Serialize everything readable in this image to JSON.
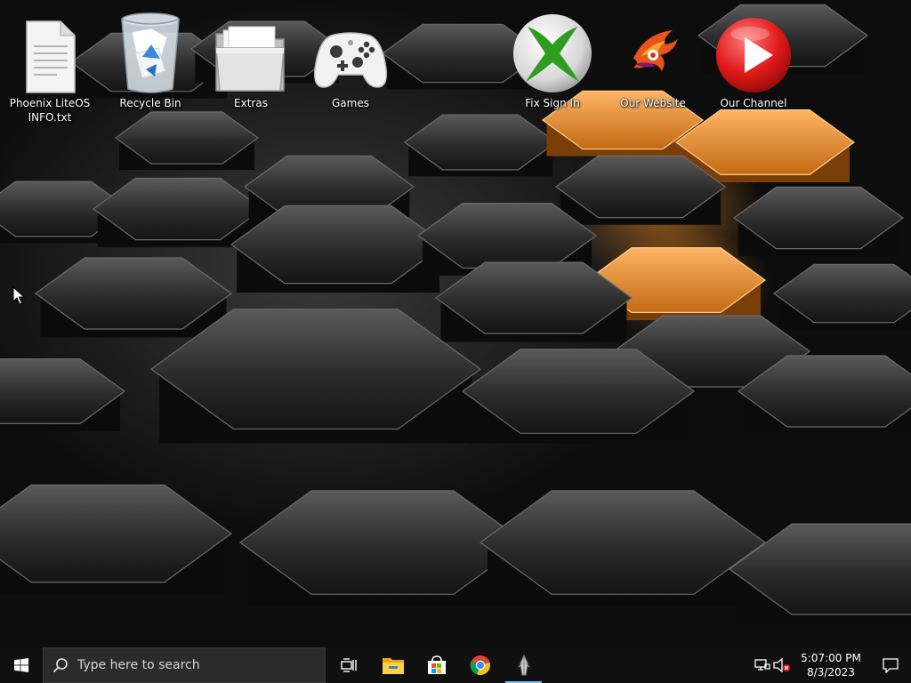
{
  "desktop": {
    "icons": [
      {
        "label": "Phoenix LiteOS\nINFO.txt",
        "icon": "text-file-icon"
      },
      {
        "label": "Recycle Bin",
        "icon": "recycle-bin-icon"
      },
      {
        "label": "Extras",
        "icon": "folder-icon"
      },
      {
        "label": "Games",
        "icon": "game-controller-icon"
      },
      {
        "label": "Fix Sign In",
        "icon": "xbox-icon"
      },
      {
        "label": "Our Website",
        "icon": "phoenix-logo-icon"
      },
      {
        "label": "Our Channel",
        "icon": "play-button-icon"
      }
    ]
  },
  "taskbar": {
    "start_icon": "windows-logo-icon",
    "search": {
      "placeholder": "Type here to search",
      "icon": "search-icon"
    },
    "apps": [
      {
        "name": "Task View",
        "icon": "task-view-icon",
        "active": false
      },
      {
        "name": "File Explorer",
        "icon": "file-explorer-icon",
        "active": false
      },
      {
        "name": "Microsoft Store",
        "icon": "store-icon",
        "active": false
      },
      {
        "name": "Google Chrome",
        "icon": "chrome-icon",
        "active": false
      },
      {
        "name": "Screenshot tool",
        "icon": "capture-tool-icon",
        "active": true
      }
    ],
    "tray": {
      "network_icon": "network-icon",
      "volume_icon": "volume-muted-icon"
    },
    "clock": {
      "time": "5:07:00 PM",
      "date": "8/3/2023"
    },
    "notifications_icon": "action-center-icon"
  },
  "colors": {
    "taskbar": "#101010",
    "search_box": "#2b2b2b",
    "accent": "#76b9ed",
    "wallpaper_glow": "#ff9628"
  }
}
